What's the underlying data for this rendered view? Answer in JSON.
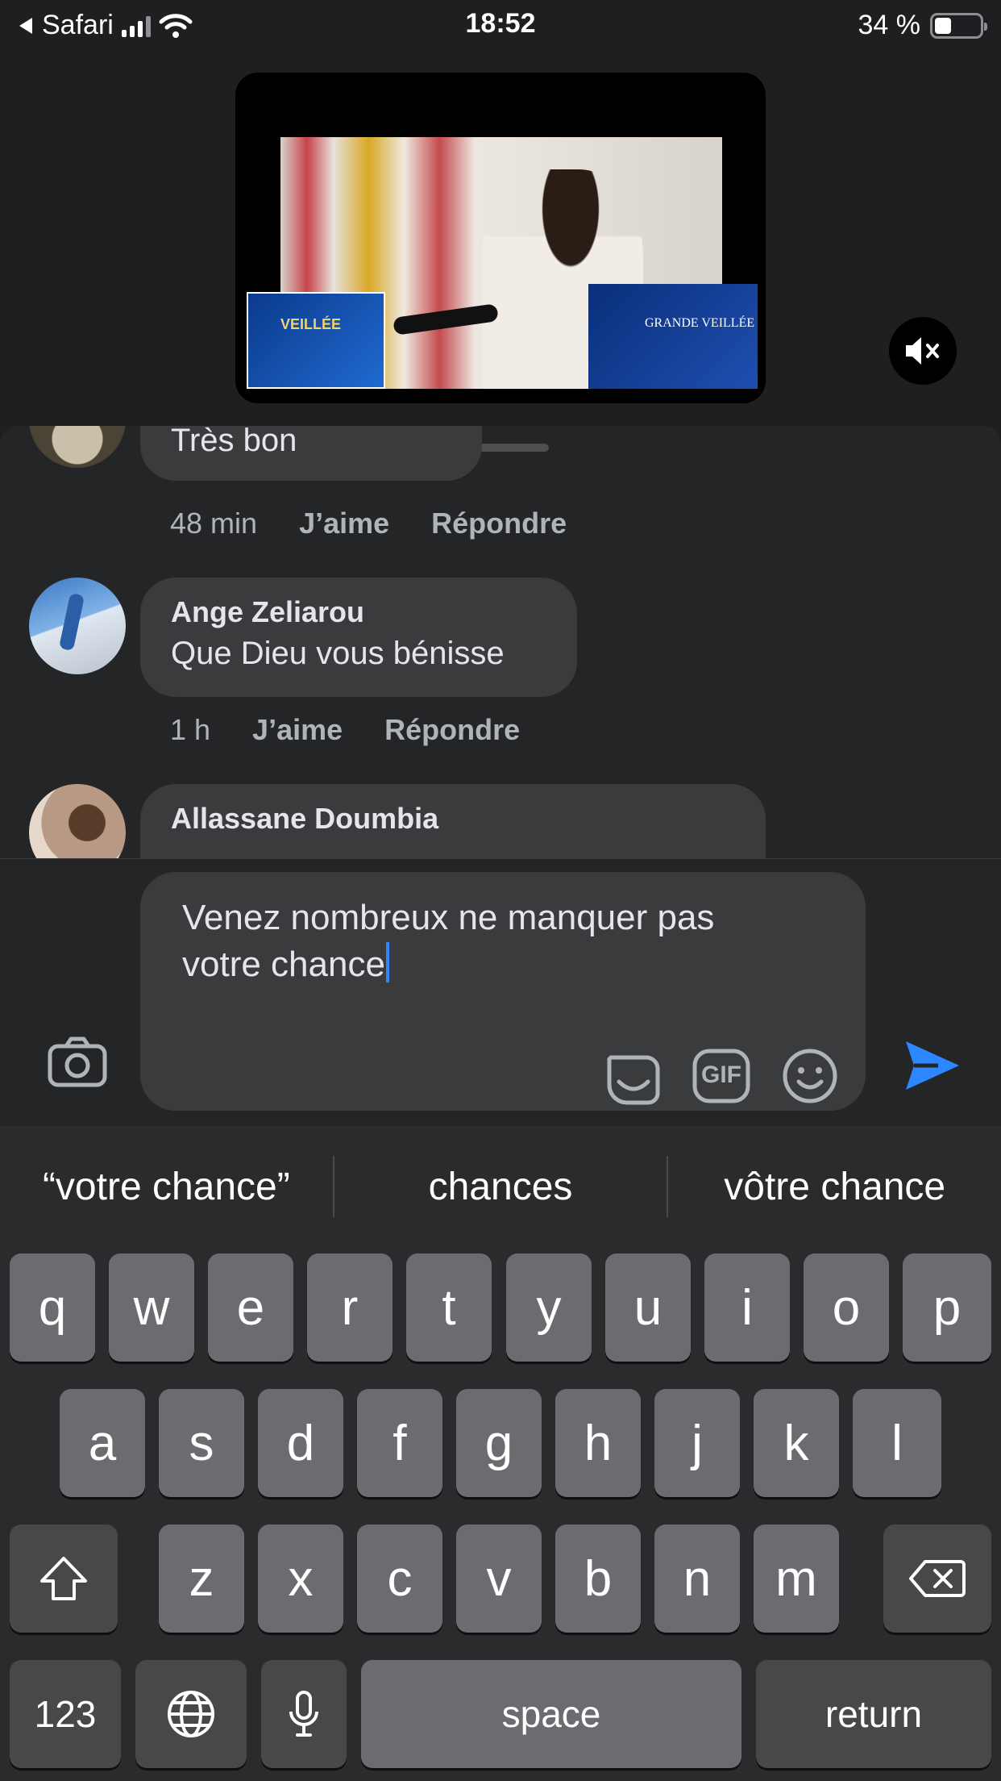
{
  "status_bar": {
    "back_app": "Safari",
    "time": "18:52",
    "battery": "34 %",
    "battery_level": 0.34
  },
  "video": {
    "poster_left_title": "VEILLÉE",
    "poster_right_title": "GRANDE VEILLÉE",
    "mute_icon": "speaker-muted-icon"
  },
  "comments": [
    {
      "name": "",
      "text": "Très bon",
      "time": "48 min",
      "like": "J’aime",
      "reply": "Répondre"
    },
    {
      "name": "Ange Zeliarou",
      "text": "Que Dieu vous bénisse",
      "time": "1 h",
      "like": "J’aime",
      "reply": "Répondre"
    },
    {
      "name": "Allassane Doumbia",
      "text": ""
    }
  ],
  "composer": {
    "input_line1": "Venez nombreux ne manquer pas",
    "input_line2": "votre chance",
    "icons": [
      "camera-icon",
      "sticker-icon",
      "gif-icon",
      "emoji-icon",
      "send-icon"
    ],
    "gif_label": "GIF",
    "send_color": "#2d88ff"
  },
  "keyboard": {
    "suggestions": [
      "“votre chance”",
      "chances",
      "vôtre chance"
    ],
    "row1": [
      "q",
      "w",
      "e",
      "r",
      "t",
      "y",
      "u",
      "i",
      "o",
      "p"
    ],
    "row2": [
      "a",
      "s",
      "d",
      "f",
      "g",
      "h",
      "j",
      "k",
      "l"
    ],
    "row3": [
      "z",
      "x",
      "c",
      "v",
      "b",
      "n",
      "m"
    ],
    "numbers_label": "123",
    "space_label": "space",
    "return_label": "return"
  }
}
